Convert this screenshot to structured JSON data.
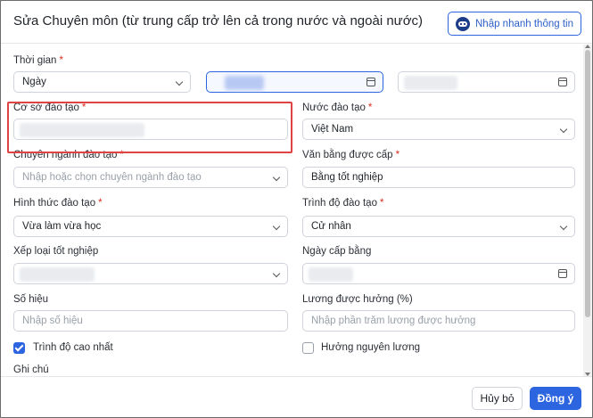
{
  "dialog": {
    "title": "Sửa Chuyên môn (từ trung cấp trở lên cả trong nước và ngoài nước)",
    "quick_fill_label": "Nhập nhanh thông tin"
  },
  "fields": {
    "time": {
      "label": "Thời gian",
      "required": "*",
      "value": "Ngày"
    },
    "school": {
      "label": "Cơ sở đào tạo",
      "required": "*"
    },
    "country": {
      "label": "Nước đào tạo",
      "required": "*",
      "value": "Việt Nam"
    },
    "major": {
      "label": "Chuyên ngành đào tạo",
      "required": "*",
      "placeholder": "Nhập hoặc chọn chuyên ngành đào tạo"
    },
    "degree": {
      "label": "Văn bằng được cấp",
      "required": "*",
      "value": "Bằng tốt nghiệp"
    },
    "study_mode": {
      "label": "Hình thức đào tạo",
      "required": "*",
      "value": "Vừa làm vừa học"
    },
    "level": {
      "label": "Trình độ đào tạo",
      "required": "*",
      "value": "Cử nhân"
    },
    "grade": {
      "label": "Xếp loại tốt nghiệp"
    },
    "issue_date": {
      "label": "Ngày cấp bằng"
    },
    "serial": {
      "label": "Số hiệu",
      "placeholder": "Nhập số hiệu"
    },
    "salary": {
      "label": "Lương được hưởng (%)",
      "placeholder": "Nhập phần trăm lương được hưởng"
    },
    "highest_level": {
      "label": "Trình độ cao nhất",
      "checked": true
    },
    "keep_salary": {
      "label": "Hưởng nguyên lương",
      "checked": false
    },
    "note": {
      "label": "Ghi chú"
    }
  },
  "footer": {
    "cancel_label": "Hủy bỏ",
    "ok_label": "Đồng ý"
  },
  "colors": {
    "accent": "#2d64e0",
    "required": "#d92d20",
    "highlight": "#e04343"
  },
  "icons": [
    "robot-icon",
    "chevron-down-icon",
    "calendar-icon",
    "checkmark-icon"
  ]
}
